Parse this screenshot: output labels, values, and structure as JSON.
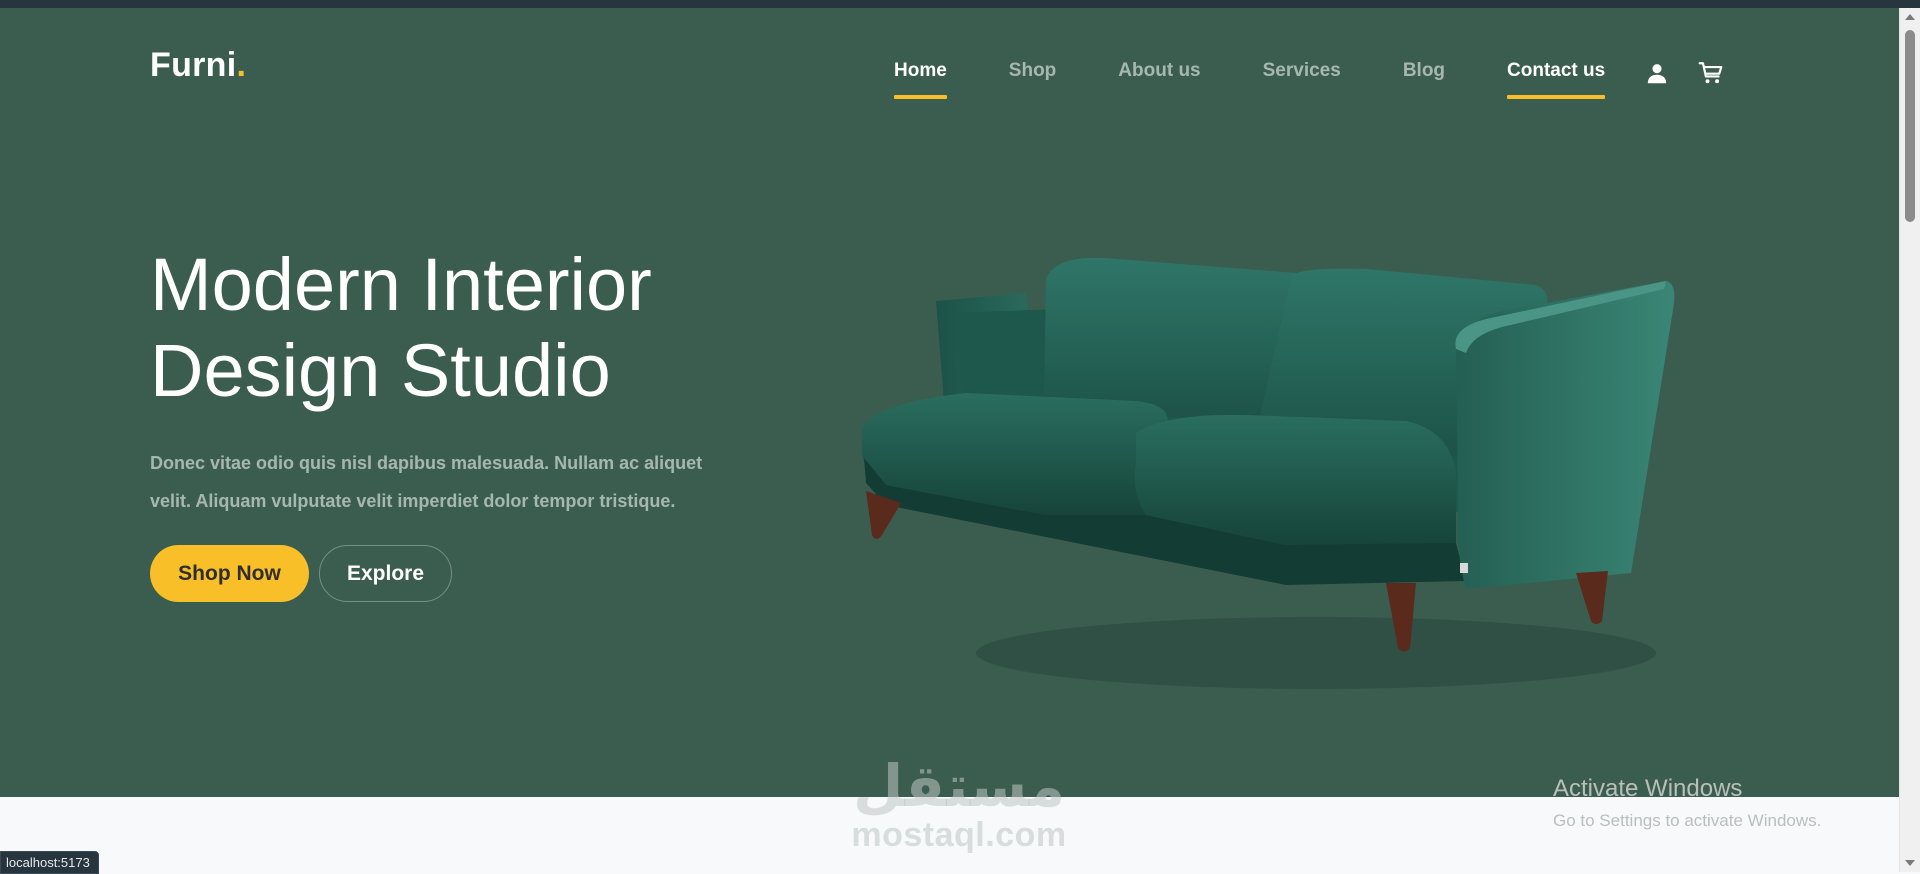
{
  "brand": {
    "name": "Furni",
    "dot": "."
  },
  "nav": {
    "items": [
      {
        "label": "Home",
        "active": true
      },
      {
        "label": "Shop",
        "active": false
      },
      {
        "label": "About us",
        "active": false
      },
      {
        "label": "Services",
        "active": false
      },
      {
        "label": "Blog",
        "active": false
      },
      {
        "label": "Contact us",
        "active": true
      }
    ],
    "icons": [
      "user-icon",
      "cart-icon"
    ]
  },
  "hero": {
    "title_line1": "Modern Interior",
    "title_line2": "Design Studio",
    "description": "Donec vitae odio quis nisl dapibus malesuada. Nullam ac aliquet velit. Aliquam vulputate velit imperdiet dolor tempor tristique.",
    "primary_button": "Shop Now",
    "secondary_button": "Explore"
  },
  "overlays": {
    "watermark_arabic": "مستقل",
    "watermark_latin": "mostaql.com",
    "activate_title": "Activate Windows",
    "activate_subtitle": "Go to Settings to activate Windows.",
    "status_url": "localhost:5173"
  },
  "colors": {
    "hero_bg": "#3b5d50",
    "accent": "#f9bf29",
    "page_bg": "#f7f9fb",
    "topbar": "#27353f"
  }
}
